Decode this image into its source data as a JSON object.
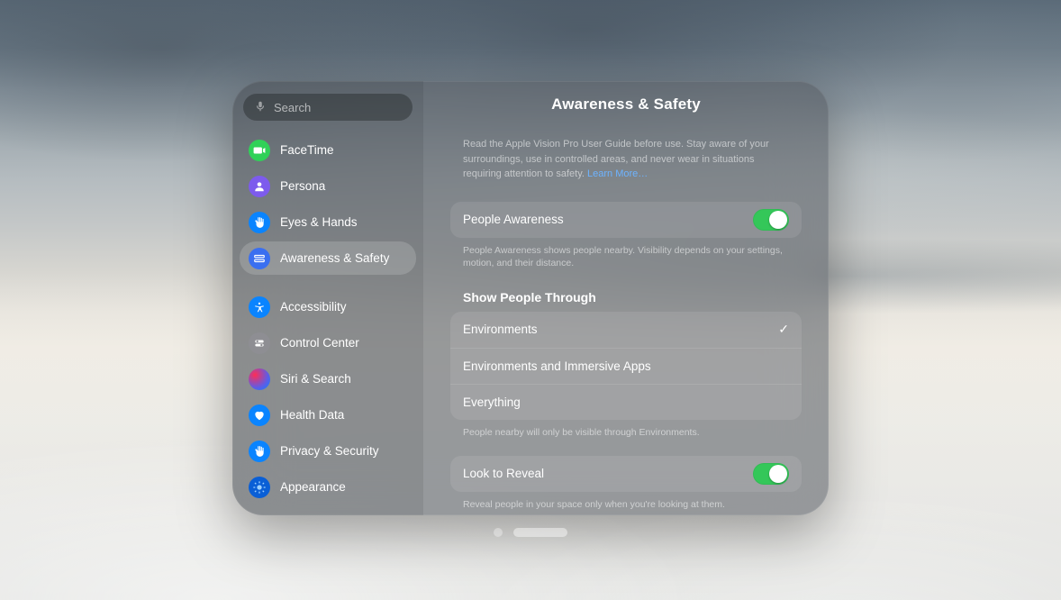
{
  "search": {
    "placeholder": "Search"
  },
  "sidebar": {
    "items": [
      {
        "label": "FaceTime",
        "icon": "facetime",
        "color": "#30d158"
      },
      {
        "label": "Persona",
        "icon": "persona",
        "color": "#7d5bed"
      },
      {
        "label": "Eyes & Hands",
        "icon": "hand",
        "color": "#0a84ff"
      },
      {
        "label": "Awareness & Safety",
        "icon": "awareness",
        "color": "#3a6ff0",
        "selected": true
      }
    ],
    "items2": [
      {
        "label": "Accessibility",
        "icon": "accessibility",
        "color": "#0a84ff"
      },
      {
        "label": "Control Center",
        "icon": "control",
        "color": "#8e8e93"
      },
      {
        "label": "Siri & Search",
        "icon": "siri",
        "color": "grad"
      },
      {
        "label": "Health Data",
        "icon": "heart",
        "color": "#0a84ff"
      },
      {
        "label": "Privacy & Security",
        "icon": "privacy",
        "color": "#0a84ff"
      },
      {
        "label": "Appearance",
        "icon": "appearance",
        "color": "#0a5fd6"
      }
    ]
  },
  "page": {
    "title": "Awareness & Safety",
    "intro_text": "Read the Apple Vision Pro User Guide before use. Stay aware of your surroundings, use in controlled areas, and never wear in situations requiring attention to safety. ",
    "intro_link": "Learn More…",
    "people_awareness": {
      "label": "People Awareness",
      "on": true,
      "footnote": "People Awareness shows people nearby. Visibility depends on your settings, motion, and their distance."
    },
    "show_people": {
      "section_label": "Show People Through",
      "options": [
        {
          "label": "Environments",
          "selected": true
        },
        {
          "label": "Environments and Immersive Apps",
          "selected": false
        },
        {
          "label": "Everything",
          "selected": false
        }
      ],
      "footnote": "People nearby will only be visible through Environments."
    },
    "look_to_reveal": {
      "label": "Look to Reveal",
      "on": true,
      "footnote": "Reveal people in your space only when you're looking at them."
    }
  }
}
